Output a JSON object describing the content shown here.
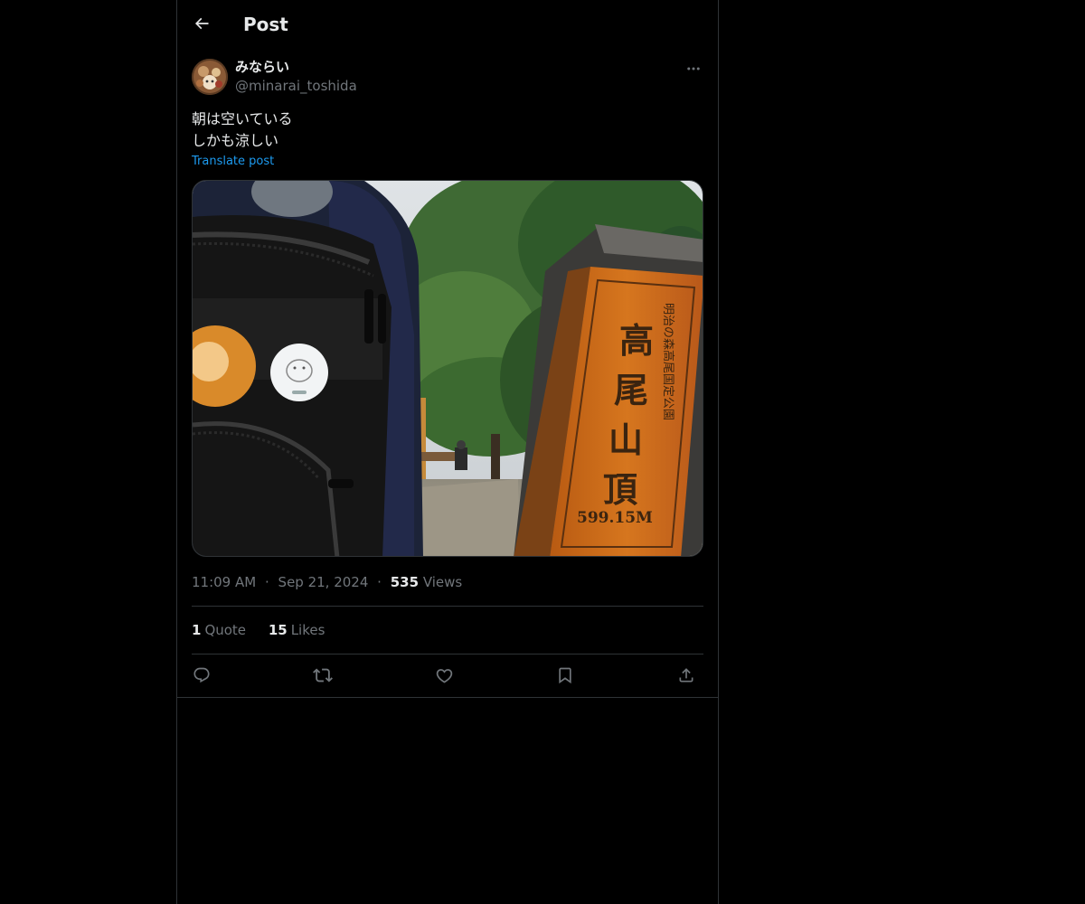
{
  "header": {
    "title": "Post",
    "back_icon": "arrow-left-icon"
  },
  "author": {
    "display_name": "みならい",
    "handle": "@minarai_toshida"
  },
  "post": {
    "lines": [
      "朝は空いている",
      "しかも涼しい"
    ],
    "translate_label": "Translate post",
    "image_sign_text": "高尾山頂",
    "image_sign_subtitle": "明治の森高尾国定公園",
    "image_sign_elevation": "599.15M"
  },
  "meta": {
    "time": "11:09 AM",
    "separator": "·",
    "date": "Sep 21, 2024",
    "views_count": "535",
    "views_label": "Views"
  },
  "stats": {
    "quotes_count": "1",
    "quotes_label": "Quote",
    "likes_count": "15",
    "likes_label": "Likes"
  },
  "actions": {
    "reply_icon": "reply-icon",
    "repost_icon": "repost-icon",
    "like_icon": "heart-icon",
    "bookmark_icon": "bookmark-icon",
    "share_icon": "share-icon"
  },
  "colors": {
    "background": "#000000",
    "text": "#e7e9ea",
    "muted": "#71767b",
    "accent": "#1d9bf0",
    "border": "#2f3336"
  }
}
